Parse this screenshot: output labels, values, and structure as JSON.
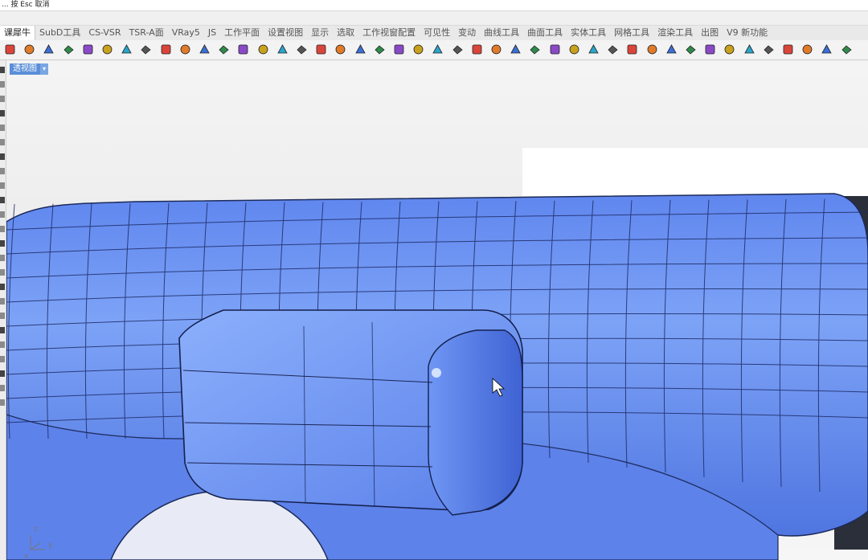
{
  "command_prompt": "... 按 Esc 取消",
  "tabs": [
    "课犀牛",
    "SubD工具",
    "CS-VSR",
    "TSR-A面",
    "VRay5",
    "JS",
    "工作平面",
    "设置视图",
    "显示",
    "选取",
    "工作视窗配置",
    "可见性",
    "变动",
    "曲线工具",
    "曲面工具",
    "实体工具",
    "网格工具",
    "渲染工具",
    "出图",
    "V9 新功能"
  ],
  "active_tab": "课犀牛",
  "toolbar_icons": [
    "new-icon",
    "sphere-icon",
    "loft-icon",
    "solid-box-icon",
    "surface-icon",
    "cube-icon",
    "texture-icon",
    "trim-icon",
    "zebra-analysis-icon",
    "flatten-icon",
    "pipe-icon",
    "mesh-grid-icon",
    "extrude-icon",
    "boolean-icon",
    "circle-point-icon",
    "polygon-icon",
    "rotate-icon",
    "cross-icon",
    "cylinder-icon",
    "plane-icon",
    "patch-icon",
    "diamond-icon",
    "box-icon",
    "lasso-icon",
    "move-icon",
    "render-icon",
    "network-icon",
    "connect-icon",
    "blend-icon",
    "arrow-down-icon",
    "bolt-icon",
    "spline-icon",
    "points-icon",
    "shape-icon",
    "blue-pencil-icon",
    "shell-icon",
    "black-square-icon",
    "cage-icon",
    "spiral-icon",
    "cube-yellow-icon",
    "curve-pencil-icon",
    "arc-icon",
    "lightbulb-icon",
    "box-blue-icon"
  ],
  "viewport": {
    "label": "透视图",
    "axes": {
      "x": "x",
      "y": "y",
      "z": "z"
    }
  },
  "colors": {
    "model_blue": "#6f97f2",
    "model_dark": "#3c5dc6",
    "viewport_tab": "#5a8fd8",
    "accent": "#4a7fd6"
  }
}
